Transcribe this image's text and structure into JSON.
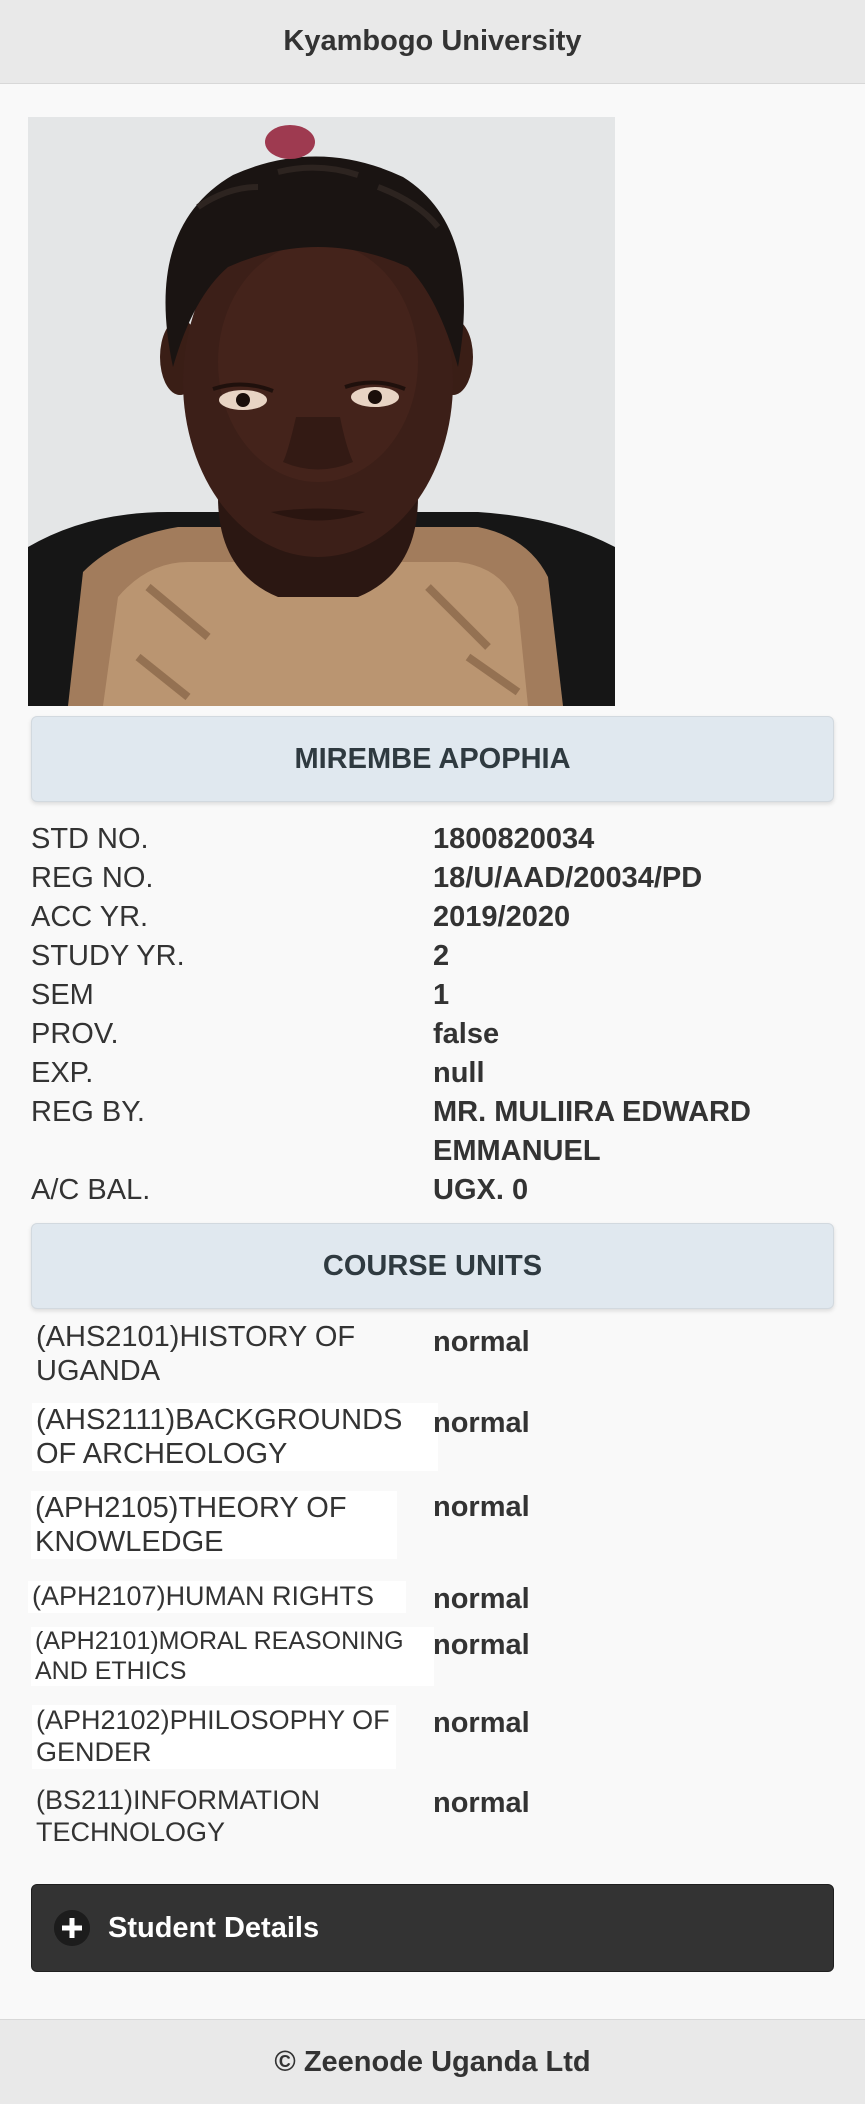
{
  "header": {
    "title": "Kyambogo University"
  },
  "student": {
    "name": "MIREMBE APOPHIA"
  },
  "info": {
    "std_no": {
      "label": "STD NO.",
      "value": "1800820034"
    },
    "reg_no": {
      "label": "REG NO.",
      "value": "18/U/AAD/20034/PD"
    },
    "acc_yr": {
      "label": "ACC YR.",
      "value": "2019/2020"
    },
    "study_yr": {
      "label": "STUDY YR.",
      "value": "2"
    },
    "sem": {
      "label": "SEM",
      "value": "1"
    },
    "prov": {
      "label": "PROV.",
      "value": "false"
    },
    "exp": {
      "label": "EXP.",
      "value": "null"
    },
    "reg_by": {
      "label": "REG BY.",
      "value": "MR. MULIIRA EDWARD EMMANUEL"
    },
    "ac_bal": {
      "label": "A/C BAL.",
      "value": "UGX. 0"
    }
  },
  "course_units": {
    "title": "COURSE UNITS",
    "items": [
      {
        "name": "(AHS2101)HISTORY OF UGANDA",
        "status": "normal"
      },
      {
        "name": "(AHS2111)BACKGROUNDS OF ARCHEOLOGY",
        "status": "normal"
      },
      {
        "name": "(APH2105)THEORY OF KNOWLEDGE",
        "status": "normal"
      },
      {
        "name": "(APH2107)HUMAN RIGHTS",
        "status": "normal"
      },
      {
        "name": "(APH2101)MORAL REASONING AND ETHICS",
        "status": "normal"
      },
      {
        "name": "(APH2102)PHILOSOPHY OF GENDER",
        "status": "normal"
      },
      {
        "name": "(BS211)INFORMATION TECHNOLOGY",
        "status": "normal"
      }
    ]
  },
  "actions": {
    "student_details_label": "Student Details"
  },
  "footer": {
    "text": "© Zeenode Uganda Ltd"
  }
}
